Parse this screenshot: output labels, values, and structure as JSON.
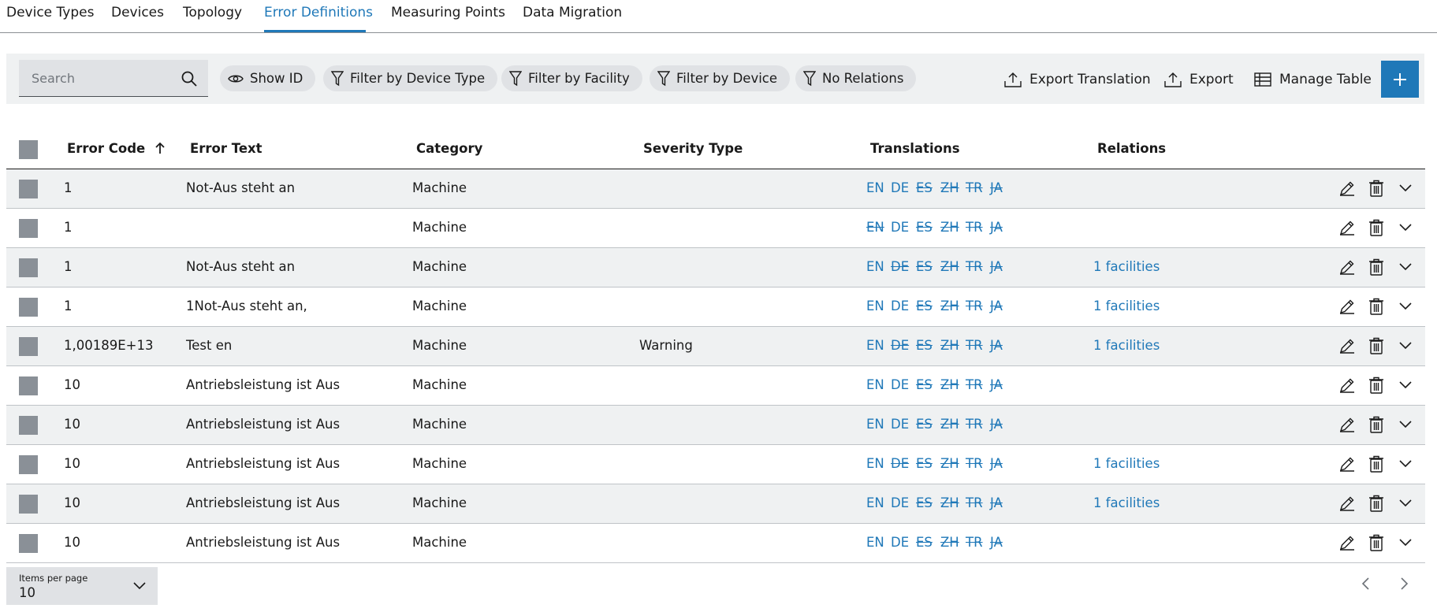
{
  "tabs": [
    {
      "label": "Device Types"
    },
    {
      "label": "Devices"
    },
    {
      "label": "Topology"
    },
    {
      "label": "Error Definitions",
      "active": true
    },
    {
      "label": "Measuring Points"
    },
    {
      "label": "Data Migration"
    }
  ],
  "toolbar": {
    "search_placeholder": "Search",
    "show_id": "Show ID",
    "filter_device_type": "Filter by Device Type",
    "filter_facility": "Filter by Facility",
    "filter_device": "Filter by Device",
    "no_relations": "No Relations",
    "export_translation": "Export Translation",
    "export": "Export",
    "manage_table": "Manage Table",
    "add_icon": "plus-icon"
  },
  "table": {
    "columns": {
      "error_code": "Error Code",
      "error_text": "Error Text",
      "category": "Category",
      "severity": "Severity Type",
      "translations": "Translations",
      "relations": "Relations"
    },
    "sort": {
      "column": "error_code",
      "direction": "ascending"
    },
    "languages": [
      "EN",
      "DE",
      "ES",
      "ZH",
      "TR",
      "JA"
    ],
    "rows": [
      {
        "code": "1",
        "text": "Not-Aus steht an",
        "category": "Machine",
        "severity": "",
        "relations": "",
        "missing": [
          "ES",
          "ZH",
          "TR",
          "JA"
        ]
      },
      {
        "code": "1",
        "text": "",
        "category": "Machine",
        "severity": "",
        "relations": "",
        "missing": [
          "EN",
          "ES",
          "ZH",
          "TR",
          "JA"
        ]
      },
      {
        "code": "1",
        "text": "Not-Aus steht an",
        "category": "Machine",
        "severity": "",
        "relations": "1 facilities",
        "missing": [
          "DE",
          "ES",
          "ZH",
          "TR",
          "JA"
        ]
      },
      {
        "code": "1",
        "text": "1Not-Aus steht an,",
        "category": "Machine",
        "severity": "",
        "relations": "1 facilities",
        "missing": [
          "ES",
          "ZH",
          "TR",
          "JA"
        ]
      },
      {
        "code": "1,00189E+13",
        "text": "Test en",
        "category": "Machine",
        "severity": "Warning",
        "relations": "1 facilities",
        "missing": [
          "DE",
          "ES",
          "ZH",
          "TR",
          "JA"
        ]
      },
      {
        "code": "10",
        "text": "Antriebsleistung ist Aus",
        "category": "Machine",
        "severity": "",
        "relations": "",
        "missing": [
          "ES",
          "ZH",
          "TR",
          "JA"
        ]
      },
      {
        "code": "10",
        "text": "Antriebsleistung ist Aus",
        "category": "Machine",
        "severity": "",
        "relations": "",
        "missing": [
          "ES",
          "ZH",
          "TR",
          "JA"
        ]
      },
      {
        "code": "10",
        "text": "Antriebsleistung ist Aus",
        "category": "Machine",
        "severity": "",
        "relations": "1 facilities",
        "missing": [
          "DE",
          "ES",
          "ZH",
          "TR",
          "JA"
        ]
      },
      {
        "code": "10",
        "text": "Antriebsleistung ist Aus",
        "category": "Machine",
        "severity": "",
        "relations": "1 facilities",
        "missing": [
          "ES",
          "ZH",
          "TR",
          "JA"
        ]
      },
      {
        "code": "10",
        "text": "Antriebsleistung ist Aus",
        "category": "Machine",
        "severity": "",
        "relations": "",
        "missing": [
          "ES",
          "ZH",
          "TR",
          "JA"
        ]
      }
    ]
  },
  "footer": {
    "items_per_page_label": "Items per page",
    "items_per_page_value": "10"
  },
  "colors": {
    "accent": "#1f78b8",
    "toolbar_bg": "#eff1f2",
    "chip_bg": "#e0e2e5",
    "checkbox": "#8a9097"
  }
}
